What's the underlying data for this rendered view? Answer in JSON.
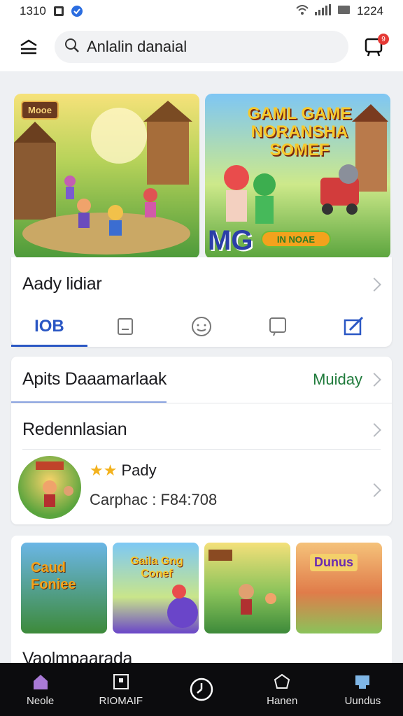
{
  "status_bar": {
    "time": "1310",
    "right_time": "1224"
  },
  "search": {
    "value": "Anlalin danaial"
  },
  "cart": {
    "badge": "9"
  },
  "banners": [
    {
      "tag": "Mooe"
    },
    {
      "headline": "GAML GAME NORANSHA SOMEF",
      "logo": "MG",
      "cta": "IN NOAE"
    }
  ],
  "section1": {
    "title": "Aady lidiar",
    "tabs": [
      {
        "label": "IOB",
        "icon": "text-tab",
        "active": true
      },
      {
        "label": "",
        "icon": "document-icon"
      },
      {
        "label": "",
        "icon": "face-icon"
      },
      {
        "label": "",
        "icon": "chat-icon"
      },
      {
        "label": "",
        "icon": "edit-icon"
      }
    ]
  },
  "section2": {
    "title": "Apits Daaamarlaak",
    "action": "Muiday",
    "row_title": "Redennlasian",
    "game": {
      "rating_label": "Pady",
      "stars": 2,
      "code": "Carphac : F84:708"
    }
  },
  "section3": {
    "thumbs": [
      "Caud Foniee",
      "Gaila Gng Conef",
      "",
      "Dunus"
    ],
    "label": "Vaolmpaarada"
  },
  "bottom_nav": [
    {
      "label": "Neole",
      "icon": "home-icon"
    },
    {
      "label": "RIOMAIF",
      "icon": "grid-icon"
    },
    {
      "label": "",
      "icon": "clock-icon"
    },
    {
      "label": "Hanen",
      "icon": "chat-icon"
    },
    {
      "label": "Uundus",
      "icon": "chart-icon"
    }
  ],
  "colors": {
    "accent": "#2a57c4",
    "green": "#1e7a3a"
  }
}
